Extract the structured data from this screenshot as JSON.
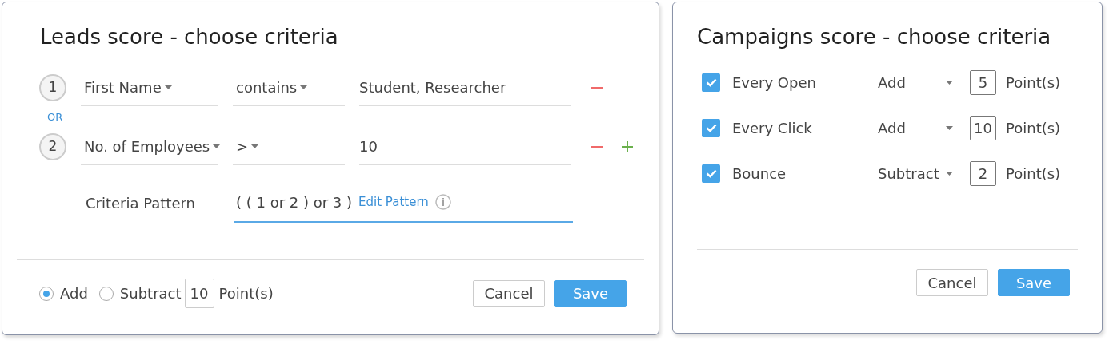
{
  "leads": {
    "title": "Leads score - choose criteria",
    "criteria": [
      {
        "number": "1",
        "field": "First Name",
        "operator": "contains",
        "value": "Student, Researcher",
        "removable": true,
        "addable": false
      },
      {
        "number": "2",
        "field": "No. of Employees",
        "operator": ">",
        "value": "10",
        "removable": true,
        "addable": true
      }
    ],
    "connector": "OR",
    "pattern": {
      "label": "Criteria Pattern",
      "value": "( ( 1 or 2 ) or 3 )",
      "link": "Edit Pattern"
    },
    "modes": [
      {
        "label": "Add",
        "selected": true
      },
      {
        "label": "Subtract",
        "selected": false
      }
    ],
    "points": "10",
    "points_unit": "Point(s)",
    "buttons": [
      {
        "label": "Cancel",
        "kind": "secondary"
      },
      {
        "label": "Save",
        "kind": "primary"
      }
    ]
  },
  "campaigns": {
    "title": "Campaigns score - choose criteria",
    "rules": [
      {
        "checked": true,
        "event": "Every Open",
        "action": "Add",
        "points": "5",
        "unit": "Point(s)"
      },
      {
        "checked": true,
        "event": "Every Click",
        "action": "Add",
        "points": "10",
        "unit": "Point(s)"
      },
      {
        "checked": true,
        "event": "Bounce",
        "action": "Subtract",
        "points": "2",
        "unit": "Point(s)"
      }
    ],
    "buttons": [
      {
        "label": "Cancel",
        "kind": "secondary"
      },
      {
        "label": "Save",
        "kind": "primary"
      }
    ]
  }
}
